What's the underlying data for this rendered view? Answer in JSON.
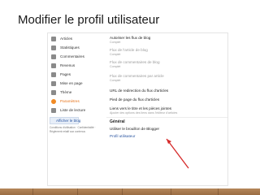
{
  "slide": {
    "title": "Modifier le profil utilisateur"
  },
  "sidebar": {
    "items": [
      {
        "label": "Articles",
        "icon": "articles-icon"
      },
      {
        "label": "Statistiques",
        "icon": "stats-icon"
      },
      {
        "label": "Commentaires",
        "icon": "comments-icon"
      },
      {
        "label": "Revenus",
        "icon": "earnings-icon"
      },
      {
        "label": "Pages",
        "icon": "pages-icon"
      },
      {
        "label": "Mise en page",
        "icon": "layout-icon"
      },
      {
        "label": "Thème",
        "icon": "theme-icon"
      },
      {
        "label": "Paramètres",
        "icon": "settings-icon"
      },
      {
        "label": "Liste de lecture",
        "icon": "reading-list-icon"
      }
    ],
    "view_blog": "Afficher le blog",
    "footer_links": [
      "Conditions d'utilisation · Confidentialité ·",
      "Règlement relatif aux contenus"
    ]
  },
  "settings": {
    "rows": [
      {
        "label": "Autoriser les flux de blog",
        "value": "Complet"
      },
      {
        "label": "Flux de l'article de blog",
        "value": "Complet"
      },
      {
        "label": "Flux de commentaires de blog",
        "value": "Complet"
      },
      {
        "label": "Flux de commentaires par article",
        "value": "Complet"
      },
      {
        "label": "URL de redirection du flux d'articles",
        "value": ""
      },
      {
        "label": "Pied de page du flux d'articles",
        "value": ""
      },
      {
        "label": "Liens vers le titre et les pièces jointes",
        "value": "Ajouter des options des liens dans l'éditeur d'articles"
      }
    ],
    "general_heading": "Général",
    "use_editor": "Utiliser le brouillon de Blogger",
    "user_profile": "Profil utilisateur"
  },
  "colors": {
    "active": "#e6731a",
    "link": "#2a55a0",
    "arrow": "#d62a2a",
    "floor": "#a9784c"
  }
}
